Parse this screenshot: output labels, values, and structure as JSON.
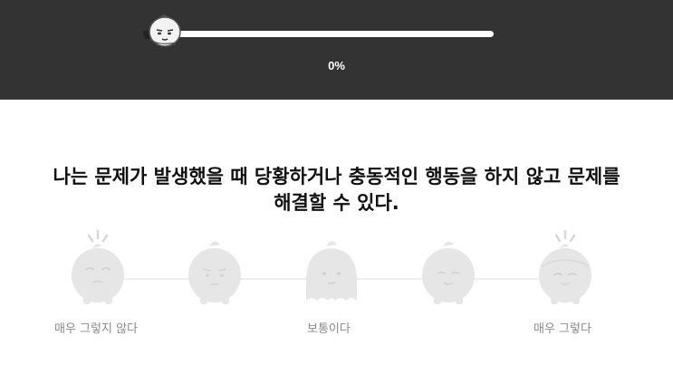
{
  "progress": {
    "percent_label": "0%",
    "value": 0
  },
  "question": {
    "line1": "나는 문제가 발생했을 때 당황하거나 충동적인 행동을 하지 않고 문제를",
    "line2": "해결할 수 있다."
  },
  "scale": {
    "labels": {
      "left": "매우 그렇지 않다",
      "middle": "보통이다",
      "right": "매우 그렇다"
    },
    "selected": null
  },
  "colors": {
    "header_bg": "#333333",
    "character": "#e6e6e6",
    "label": "#8a8a8a"
  }
}
